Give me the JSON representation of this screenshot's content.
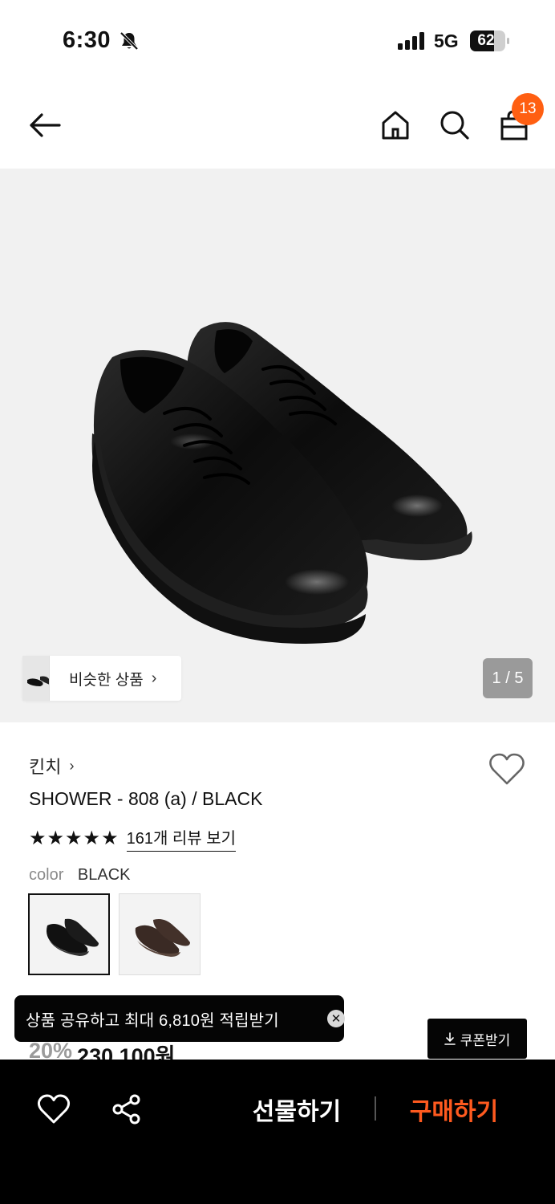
{
  "status_bar": {
    "time": "6:30",
    "network": "5G",
    "battery": "62"
  },
  "header": {
    "cart_count": "13",
    "icons": [
      "back-arrow-icon",
      "home-icon",
      "search-icon",
      "shopping-bag-icon"
    ]
  },
  "gallery": {
    "similar_label": "비슷한 상품",
    "similar_chevron": "›",
    "counter": "1 / 5"
  },
  "product": {
    "brand": "킨치",
    "brand_chevron": "›",
    "title": "SHOWER - 808 (a) / BLACK",
    "rating_stars": 5,
    "reviews_label": "161개 리뷰 보기",
    "color_label": "color",
    "color_value": "BLACK",
    "color_options": [
      "black",
      "brown"
    ]
  },
  "price": {
    "discount": "20%",
    "amount": "230,100원"
  },
  "toast": {
    "text": "상품 공유하고 최대 6,810원 적립받기",
    "close": "✕"
  },
  "coupon": {
    "label": "쿠폰받기"
  },
  "bottom_bar": {
    "gift_label": "선물하기",
    "buy_label": "구매하기",
    "buy_color": "#ff5a1f"
  },
  "colors": {
    "accent": "#ff5f12",
    "dark": "#050505"
  }
}
